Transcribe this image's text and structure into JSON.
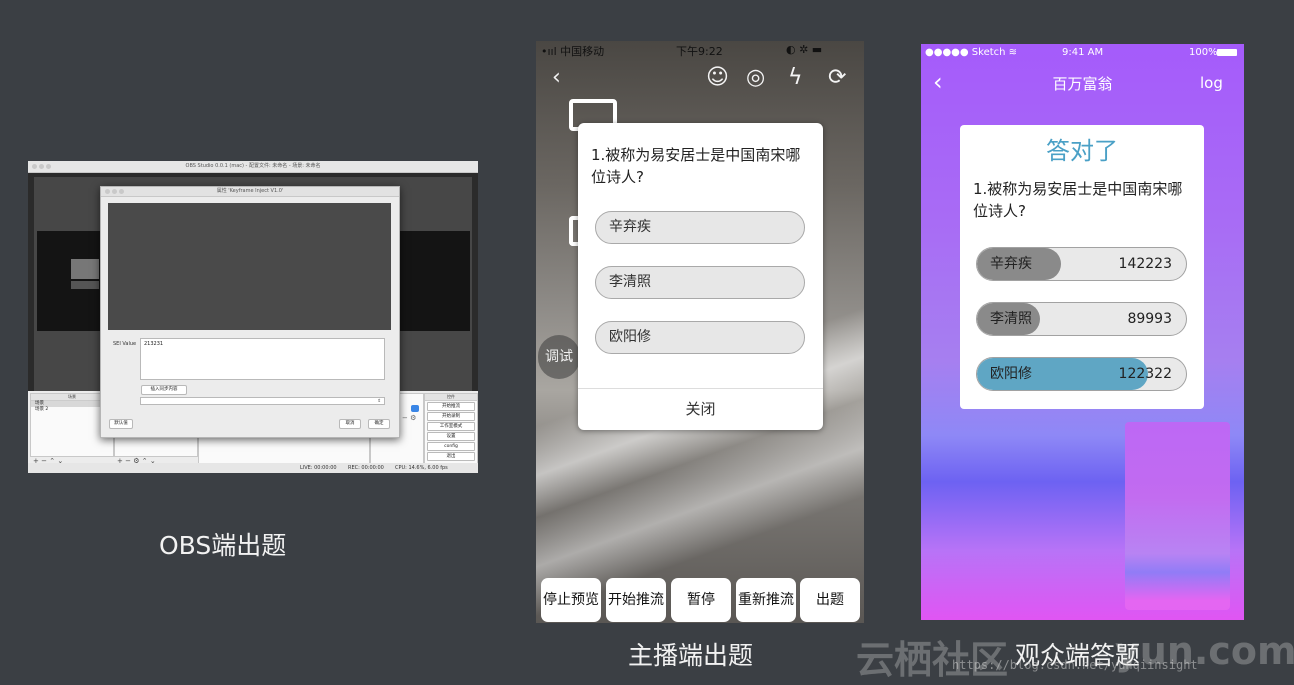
{
  "obs": {
    "window_title": "OBS Studio 0.0.1 (mac) - 配置文件: 未命名 - 场景: 未命名",
    "dialog_title": "属性 'Keyframe Inject V1.0'",
    "sei_label": "SEI Value",
    "sei_value": "213231",
    "insert_button": "插入同步内容",
    "select_arrow": "⇕",
    "defaults_button": "默认值",
    "cancel_button": "取消",
    "ok_button": "确定",
    "scenes_header": "场景",
    "scenes": [
      "场景",
      "场景 2"
    ],
    "controls_header": "控件",
    "controls": [
      "开始推流",
      "开始录制",
      "工作室模式",
      "设置",
      "config",
      "退出"
    ],
    "status": {
      "live": "LIVE: 00:00:00",
      "rec": "REC: 00:00:00",
      "cpu": "CPU: 14.6%, 6.00 fps"
    },
    "caption": "OBS端出题"
  },
  "host": {
    "carrier": "•ııl 中国移动",
    "time": "下午9:22",
    "status_right": "◐ ✲ ▬",
    "side_chip": "调试",
    "question": "1.被称为易安居士是中国南宋哪位诗人?",
    "options": [
      "辛弃疾",
      "李清照",
      "欧阳修"
    ],
    "close_label": "关闭",
    "toolbar": [
      "停止预览",
      "开始推流",
      "暂停",
      "重新推流",
      "出题"
    ],
    "caption": "主播端出题"
  },
  "audience": {
    "carrier": "●●●●● Sketch ≋",
    "time": "9:41 AM",
    "battery": "100%",
    "nav_title": "百万富翁",
    "log_label": "log",
    "result": "答对了",
    "question": "1.被称为易安居士是中国南宋哪位诗人?",
    "answers": [
      {
        "label": "辛弃疾",
        "count": "142223",
        "share": 0.4,
        "color": "#8a8a8a"
      },
      {
        "label": "李清照",
        "count": "89993",
        "share": 0.3,
        "color": "#8a8a8a"
      },
      {
        "label": "欧阳修",
        "count": "122322",
        "share": 0.82,
        "color": "#5fa6c4"
      }
    ],
    "caption": "观众端答题"
  },
  "watermark": {
    "brand": "云栖社区",
    "url": "https://blog.csdn.net/yunqiinsight",
    "domain_text": "yun.com"
  }
}
